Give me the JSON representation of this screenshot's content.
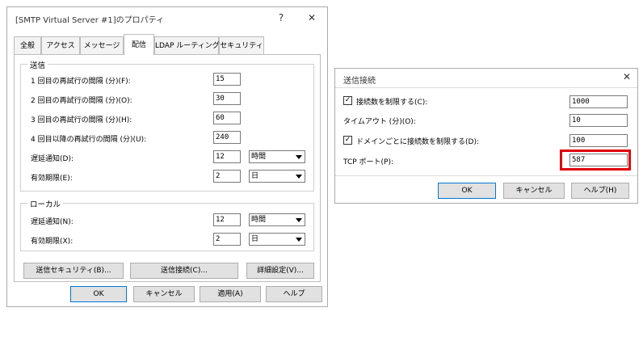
{
  "dlg1": {
    "title": "[SMTP Virtual Server #1]のプロパティ",
    "help_glyph": "?",
    "close_glyph": "✕",
    "tabs": [
      "全般",
      "アクセス",
      "メッセージ",
      "配信",
      "LDAP ルーティング",
      "セキュリティ"
    ],
    "outbound": {
      "group_label": "送信",
      "retry1_label": "1 回目の再試行の間隔 (分)(F):",
      "retry1_value": "15",
      "retry2_label": "2 回目の再試行の間隔 (分)(O):",
      "retry2_value": "30",
      "retry3_label": "3 回目の再試行の間隔 (分)(H):",
      "retry3_value": "60",
      "retry4_label": "4 回目以降の再試行の間隔 (分)(U):",
      "retry4_value": "240",
      "delay_label": "遅延通知(D):",
      "delay_value": "12",
      "delay_unit": "時間",
      "expire_label": "有効期限(E):",
      "expire_value": "2",
      "expire_unit": "日"
    },
    "local": {
      "group_label": "ローカル",
      "delay_label": "遅延通知(N):",
      "delay_value": "12",
      "delay_unit": "時間",
      "expire_label": "有効期限(X):",
      "expire_value": "2",
      "expire_unit": "日"
    },
    "buttons": {
      "outbound_security": "送信セキュリティ(B)...",
      "outbound_connections": "送信接続(C)...",
      "advanced": "詳細設定(V)..."
    },
    "footer": {
      "ok": "OK",
      "cancel": "キャンセル",
      "apply": "適用(A)",
      "help": "ヘルプ"
    }
  },
  "dlg2": {
    "title": "送信接続",
    "close_glyph": "✕",
    "limit_connections_label": "接続数を制限する(C):",
    "limit_connections_value": "1000",
    "timeout_label": "タイムアウト (分)(O):",
    "timeout_value": "10",
    "limit_per_domain_label": "ドメインごとに接続数を制限する(D):",
    "limit_per_domain_value": "100",
    "tcp_port_label": "TCP ポート(P):",
    "tcp_port_value": "587",
    "checkmark": "✓",
    "footer": {
      "ok": "OK",
      "cancel": "キャンセル",
      "help": "ヘルプ(H)"
    },
    "highlight_color": "#e00000"
  }
}
